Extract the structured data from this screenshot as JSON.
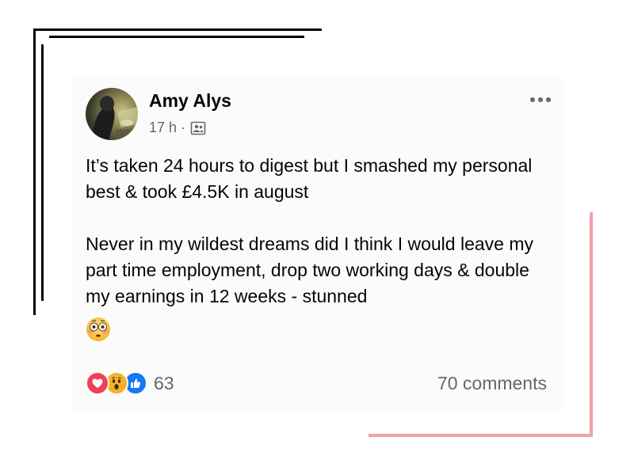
{
  "post": {
    "author": "Amy Alys",
    "time": "17 h",
    "separator": "·",
    "audience_icon": "friends-audience-icon",
    "paragraph_1": "It’s taken 24 hours to digest but I smashed my personal best & took £4.5K in august",
    "paragraph_2": "Never in my wildest dreams did I think I would leave my part time employment, drop two working days & double my earnings in 12 weeks - stunned",
    "emoji": "flushed-face-emoji"
  },
  "footer": {
    "reaction_icons": [
      "love-reaction-icon",
      "wow-reaction-icon",
      "like-reaction-icon"
    ],
    "reaction_count": "63",
    "comments": "70 comments"
  },
  "colors": {
    "text": "#050505",
    "secondary": "#65676b",
    "card_bg": "#fbfbfb",
    "love": "#f33e58",
    "like": "#1877f2",
    "wow": "#f7b125",
    "frame_pink": "#f4a0aa"
  }
}
